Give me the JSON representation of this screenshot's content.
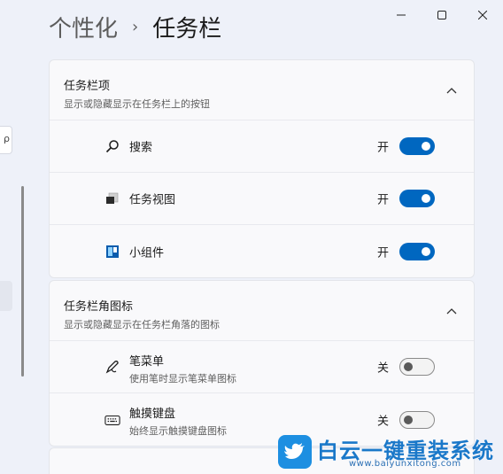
{
  "window": {
    "minimize_icon": "minimize-icon",
    "maximize_icon": "maximize-icon",
    "close_icon": "close-icon"
  },
  "breadcrumb": {
    "parent": "个性化",
    "separator": "›",
    "current": "任务栏"
  },
  "sidebar": {
    "search_hint": "ρ"
  },
  "groups": [
    {
      "title": "任务栏项",
      "subtitle": "显示或隐藏显示在任务栏上的按钮",
      "expanded": true,
      "items": [
        {
          "icon": "search-icon",
          "label": "搜索",
          "state": "开",
          "on": true
        },
        {
          "icon": "task-view-icon",
          "label": "任务视图",
          "state": "开",
          "on": true
        },
        {
          "icon": "widgets-icon",
          "label": "小组件",
          "state": "开",
          "on": true
        }
      ]
    },
    {
      "title": "任务栏角图标",
      "subtitle": "显示或隐藏显示在任务栏角落的图标",
      "expanded": true,
      "items": [
        {
          "icon": "pen-icon",
          "label": "笔菜单",
          "sub": "使用笔时显示笔菜单图标",
          "state": "关",
          "on": false
        },
        {
          "icon": "keyboard-icon",
          "label": "触摸键盘",
          "sub": "始终显示触摸键盘图标",
          "state": "关",
          "on": false
        }
      ]
    }
  ],
  "watermark": {
    "text": "白云一键重装系统",
    "url": "www.baiyunxitong.com"
  },
  "colors": {
    "accent": "#0067c0",
    "background": "#eef1f9",
    "card": "#f9f9fb"
  }
}
